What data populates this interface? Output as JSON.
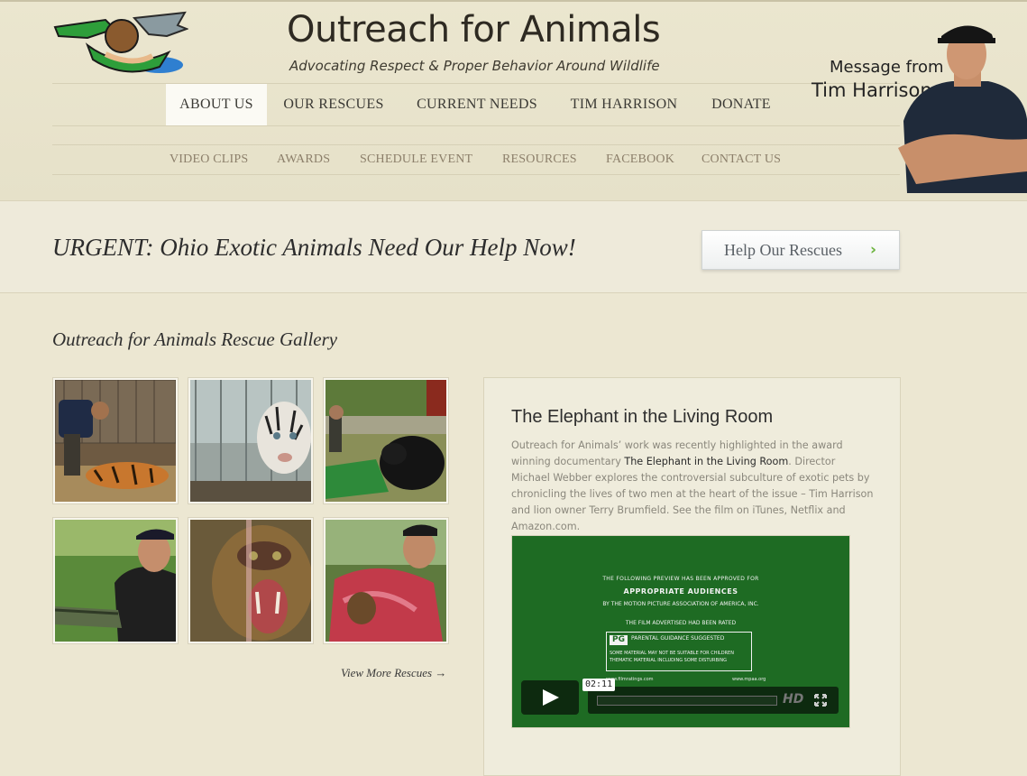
{
  "site": {
    "title": "Outreach for Animals",
    "tagline": "Advocating Respect & Proper Behavior Around Wildlife"
  },
  "nav_main": [
    {
      "label": "ABOUT US",
      "active": true
    },
    {
      "label": "OUR RESCUES",
      "active": false
    },
    {
      "label": "CURRENT NEEDS",
      "active": false
    },
    {
      "label": "TIM HARRISON",
      "active": false
    },
    {
      "label": "DONATE",
      "active": false
    }
  ],
  "nav_sub": [
    "VIDEO CLIPS",
    "AWARDS",
    "SCHEDULE EVENT",
    "RESOURCES",
    "FACEBOOK",
    "CONTACT US"
  ],
  "message": {
    "line1": "Message from",
    "line2": "Tim Harrison"
  },
  "urgent": {
    "text": "URGENT: Ohio Exotic Animals Need Our Help Now!",
    "button_label": "Help Our Rescues",
    "button_icon": "chevron-right-icon"
  },
  "gallery": {
    "heading": "Outreach for Animals Rescue Gallery",
    "view_more": "View More Rescues →",
    "thumbs": [
      "tiger-rescue",
      "white-tiger",
      "black-bear",
      "alligator",
      "mandrill",
      "monkey-in-blanket"
    ]
  },
  "feature": {
    "title": "The Elephant in the Living Room",
    "desc_part1": "Outreach for Animals’ work was recently highlighted in the award winning documentary ",
    "desc_link": "The Elephant in the Living Room",
    "desc_part2": ".  Director Michael Webber explores the controversial subculture of exotic pets by chronicling the lives of two men at the heart of the issue – Tim Harrison and lion owner Terry Brumfield.  See the film on iTunes, Netflix and Amazon.com."
  },
  "video": {
    "line1": "THE FOLLOWING PREVIEW HAS BEEN APPROVED FOR",
    "line2": "APPROPRIATE AUDIENCES",
    "line3": "BY THE MOTION PICTURE ASSOCIATION OF AMERICA, INC.",
    "line4": "THE FILM ADVERTISED HAD BEEN RATED",
    "pg": "PG",
    "pg_text": "PARENTAL GUIDANCE SUGGESTED",
    "box_line2": "SOME MATERIAL MAY NOT BE SUITABLE FOR CHILDREN",
    "box_line3": "THEMATIC MATERIAL INCLUDING SOME DISTURBING",
    "site_left": "www.filmratings.com",
    "site_right": "www.mpaa.org",
    "time": "02:11",
    "hd_label": "HD"
  },
  "colors": {
    "page_bg": "#ece7d2",
    "accent_green": "#6cb33e",
    "video_green": "#1e6b23"
  }
}
